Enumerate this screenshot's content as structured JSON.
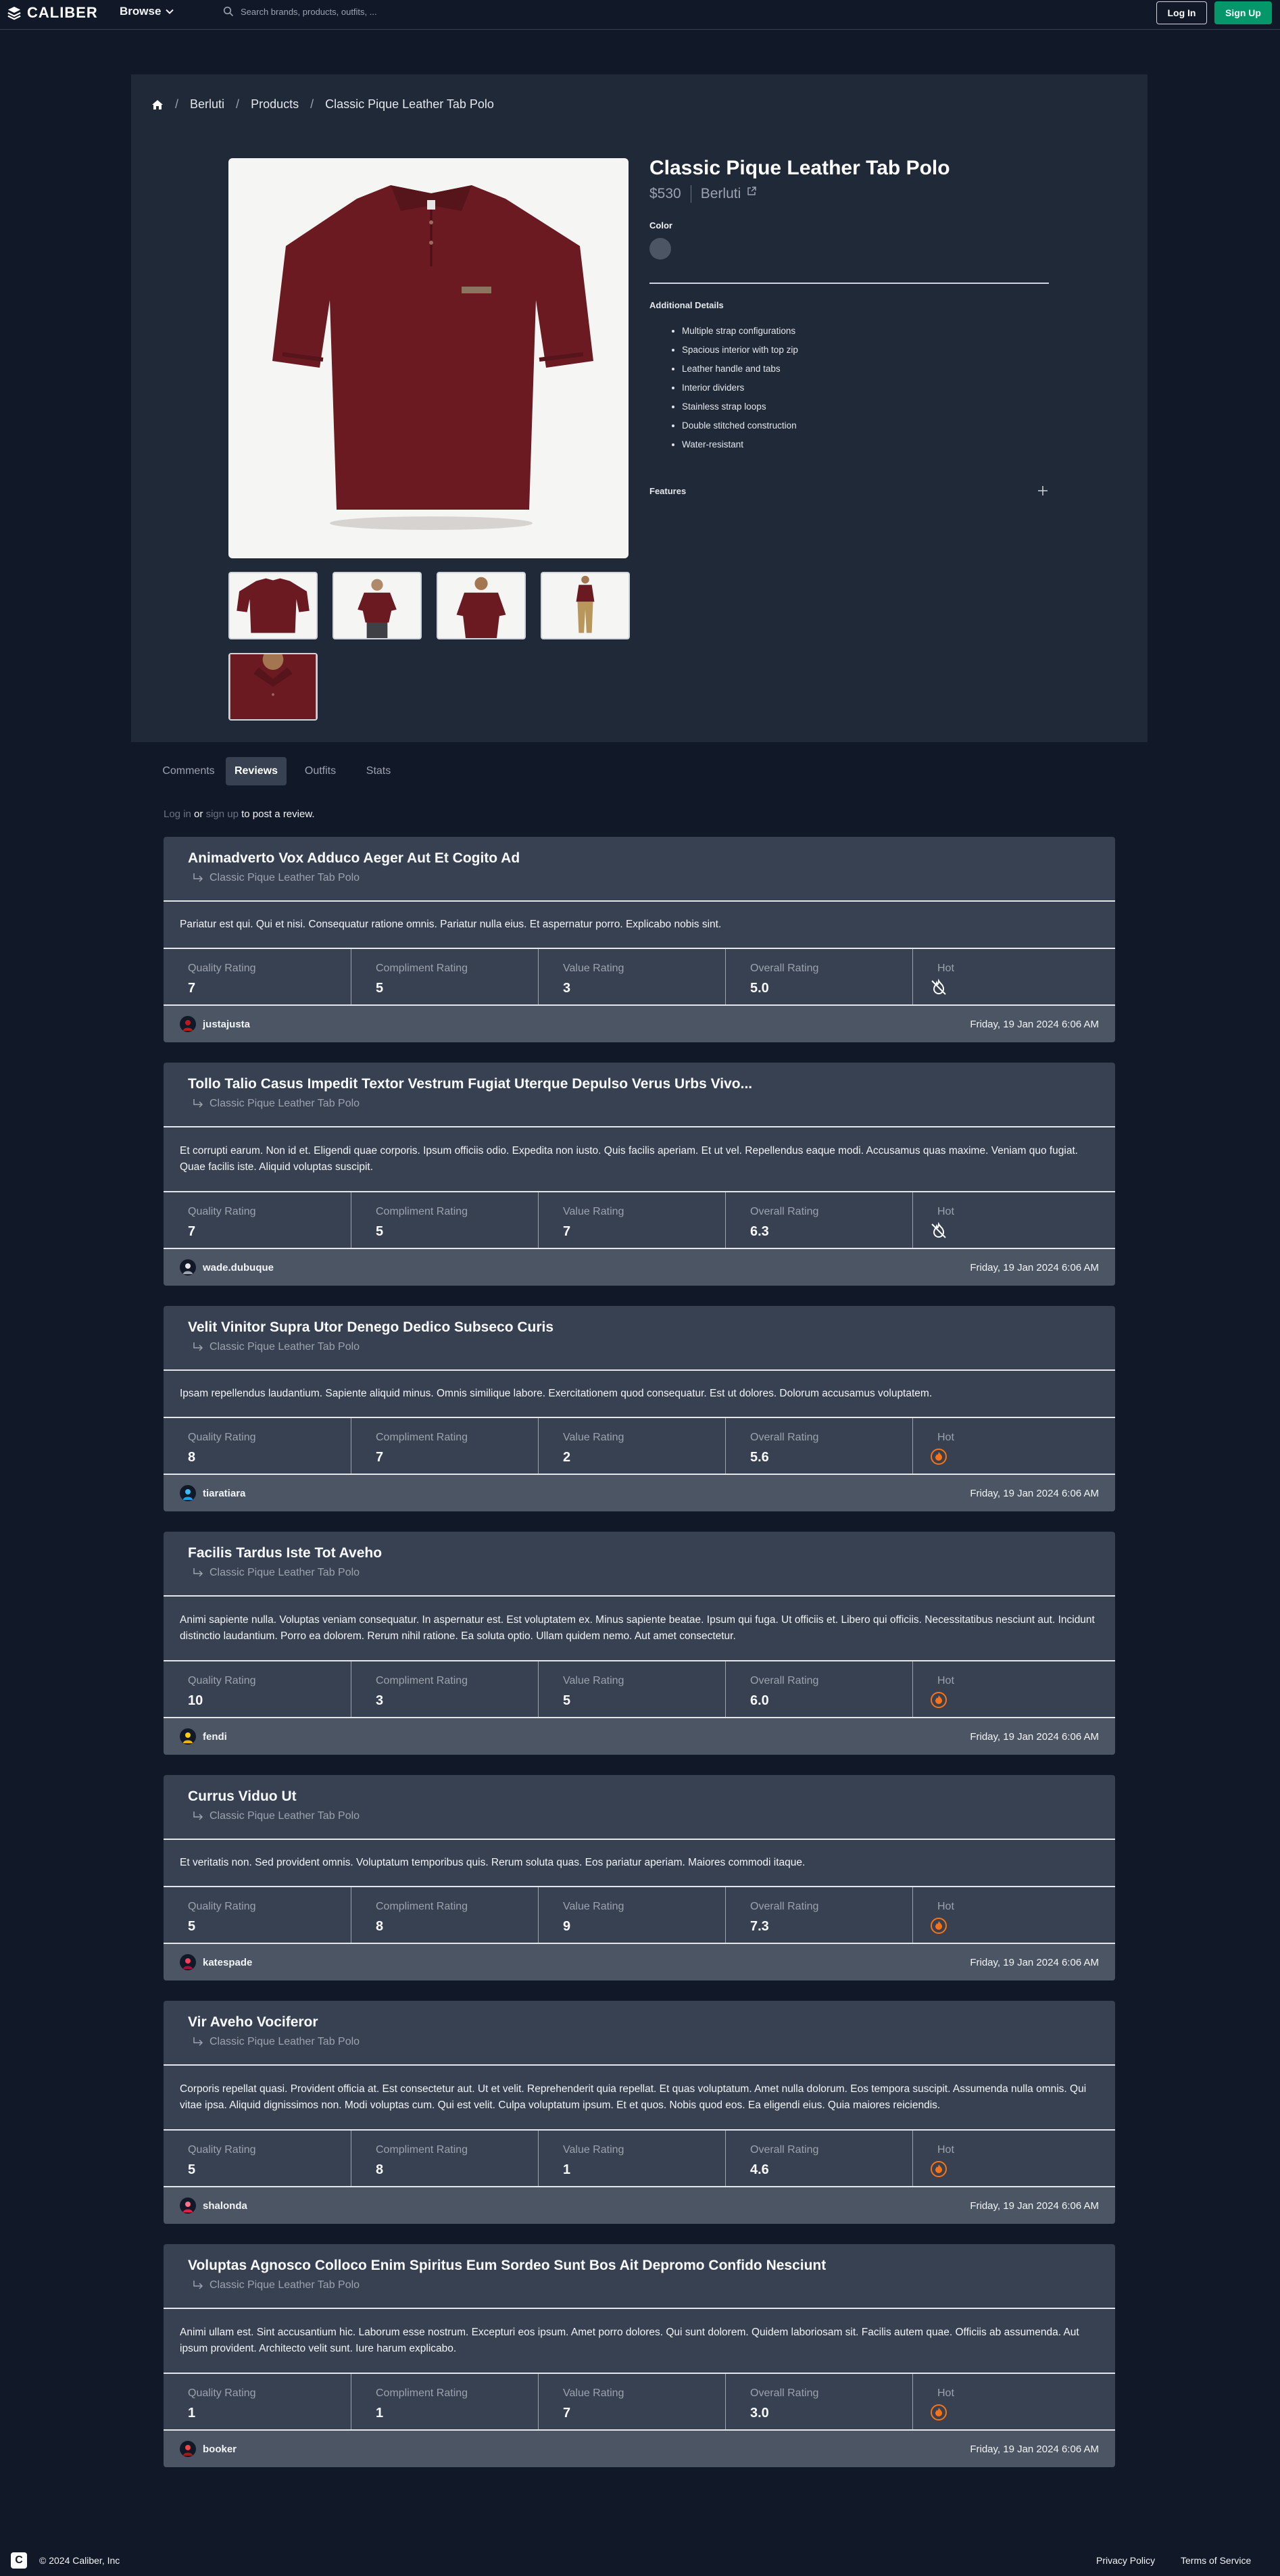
{
  "nav": {
    "brand": "CALIBER",
    "browse_label": "Browse",
    "search_placeholder": "Search brands, products, outfits, ...",
    "login_label": "Log In",
    "signup_label": "Sign Up"
  },
  "breadcrumb": [
    "Berluti",
    "Products",
    "Classic Pique Leather Tab Polo"
  ],
  "product": {
    "title": "Classic Pique Leather Tab Polo",
    "price": "$530",
    "brand": "Berluti",
    "color_label": "Color",
    "additional_details_label": "Additional Details",
    "details": [
      "Multiple strap configurations",
      "Spacious interior with top zip",
      "Leather handle and tabs",
      "Interior dividers",
      "Stainless strap loops",
      "Double stitched construction",
      "Water-resistant"
    ],
    "features_label": "Features",
    "swatch_color": "#4b5563",
    "shirt_color": "#6b1a22"
  },
  "tabs": [
    {
      "label": "Comments",
      "active": false
    },
    {
      "label": "Reviews",
      "active": true
    },
    {
      "label": "Outfits",
      "active": false
    },
    {
      "label": "Stats",
      "active": false
    }
  ],
  "post_note": {
    "login": "Log in",
    "or": "or",
    "signup": "sign up",
    "suffix": "to post a review."
  },
  "rating_labels": {
    "quality": "Quality Rating",
    "compliment": "Compliment Rating",
    "value": "Value Rating",
    "overall": "Overall Rating",
    "hot": "Hot"
  },
  "reviews": [
    {
      "title": "Animadverto Vox Adduco Aeger Aut Et Cogito Ad",
      "product": "Classic Pique Leather Tab Polo",
      "body": "Pariatur est qui. Qui et nisi. Consequatur ratione omnis. Pariatur nulla eius. Et aspernatur porro. Explicabo nobis sint.",
      "quality": "7",
      "compliment": "5",
      "value": "3",
      "overall": "5.0",
      "hot_icon": "not-hot-icon",
      "user": "justajusta",
      "date": "Friday, 19 Jan 2024 6:06 AM"
    },
    {
      "title": "Tollo Talio Casus Impedit Textor Vestrum Fugiat Uterque Depulso Verus Urbs Vivo...",
      "product": "Classic Pique Leather Tab Polo",
      "body": "Et corrupti earum. Non id et. Eligendi quae corporis. Ipsum officiis odio. Expedita non iusto. Quis facilis aperiam. Et ut vel. Repellendus eaque modi. Accusamus quas maxime. Veniam quo fugiat. Quae facilis iste. Aliquid voluptas suscipit.",
      "quality": "7",
      "compliment": "5",
      "value": "7",
      "overall": "6.3",
      "hot_icon": "not-hot-icon",
      "user": "wade.dubuque",
      "date": "Friday, 19 Jan 2024 6:06 AM"
    },
    {
      "title": "Velit Vinitor Supra Utor Denego Dedico Subseco Curis",
      "product": "Classic Pique Leather Tab Polo",
      "body": "Ipsam repellendus laudantium. Sapiente aliquid minus. Omnis similique labore. Exercitationem quod consequatur. Est ut dolores. Dolorum accusamus voluptatem.",
      "quality": "8",
      "compliment": "7",
      "value": "2",
      "overall": "5.6",
      "hot_icon": "flame-icon",
      "user": "tiaratiara",
      "date": "Friday, 19 Jan 2024 6:06 AM"
    },
    {
      "title": "Facilis Tardus Iste Tot Aveho",
      "product": "Classic Pique Leather Tab Polo",
      "body": "Animi sapiente nulla. Voluptas veniam consequatur. In aspernatur est. Est voluptatem ex. Minus sapiente beatae. Ipsum qui fuga. Ut officiis et. Libero qui officiis. Necessitatibus nesciunt aut. Incidunt distinctio laudantium. Porro ea dolorem. Rerum nihil ratione. Ea soluta optio. Ullam quidem nemo. Aut amet consectetur.",
      "quality": "10",
      "compliment": "3",
      "value": "5",
      "overall": "6.0",
      "hot_icon": "flame-icon",
      "user": "fendi",
      "date": "Friday, 19 Jan 2024 6:06 AM"
    },
    {
      "title": "Currus Viduo Ut",
      "product": "Classic Pique Leather Tab Polo",
      "body": "Et veritatis non. Sed provident omnis. Voluptatum temporibus quis. Rerum soluta quas. Eos pariatur aperiam. Maiores commodi itaque.",
      "quality": "5",
      "compliment": "8",
      "value": "9",
      "overall": "7.3",
      "hot_icon": "flame-icon",
      "user": "katespade",
      "date": "Friday, 19 Jan 2024 6:06 AM"
    },
    {
      "title": "Vir Aveho Vociferor",
      "product": "Classic Pique Leather Tab Polo",
      "body": "Corporis repellat quasi. Provident officia at. Est consectetur aut. Ut et velit. Reprehenderit quia repellat. Et quas voluptatum. Amet nulla dolorum. Eos tempora suscipit. Assumenda nulla omnis. Qui vitae ipsa. Aliquid dignissimos non. Modi voluptas cum. Qui est velit. Culpa voluptatum ipsum. Et et quos. Nobis quod eos. Ea eligendi eius. Quia maiores reiciendis.",
      "quality": "5",
      "compliment": "8",
      "value": "1",
      "overall": "4.6",
      "hot_icon": "flame-icon",
      "user": "shalonda",
      "date": "Friday, 19 Jan 2024 6:06 AM"
    },
    {
      "title": "Voluptas Agnosco Colloco Enim Spiritus Eum Sordeo Sunt Bos Ait Depromo Confido Nesciunt",
      "product": "Classic Pique Leather Tab Polo",
      "body": "Animi ullam est. Sint accusantium hic. Laborum esse nostrum. Excepturi eos ipsum. Amet porro dolores. Qui sunt dolorem. Quidem laboriosam sit. Facilis autem quae. Officiis ab assumenda. Aut ipsum provident. Architecto velit sunt. Iure harum explicabo.",
      "quality": "1",
      "compliment": "1",
      "value": "7",
      "overall": "3.0",
      "hot_icon": "flame-icon",
      "user": "booker",
      "date": "Friday, 19 Jan 2024 6:06 AM"
    }
  ],
  "footer": {
    "logo_letter": "C",
    "copyright": "© 2024 Caliber, Inc",
    "privacy": "Privacy Policy",
    "terms": "Terms of Service"
  },
  "colors": {
    "background": "#111827",
    "panel": "#1f2937",
    "card": "#374151",
    "card_footer": "#4b5563",
    "accent_green": "#059669",
    "hot_orange": "#f97316"
  }
}
